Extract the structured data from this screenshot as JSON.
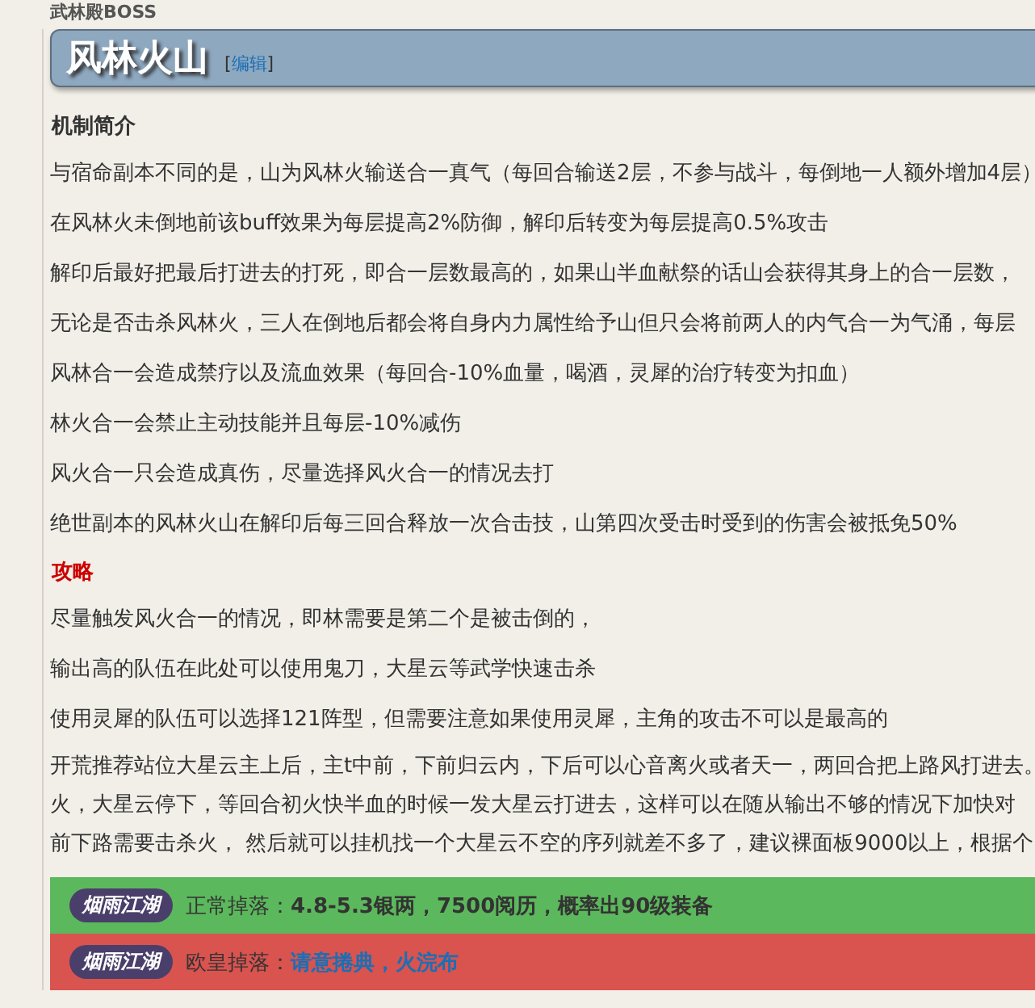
{
  "breadcrumb": "武林殿BOSS",
  "heading": {
    "title": "风林火山",
    "bracket_open": "[",
    "edit_link": "编辑",
    "bracket_close": "]"
  },
  "sections": [
    {
      "kind": "subtitle",
      "text": "机制简介"
    },
    {
      "kind": "para",
      "text": "与宿命副本不同的是，山为风林火输送合一真气（每回合输送2层，不参与战斗，每倒地一人额外增加4层）"
    },
    {
      "kind": "para",
      "text": "在风林火未倒地前该buff效果为每层提高2%防御，解印后转变为每层提高0.5%攻击"
    },
    {
      "kind": "para",
      "text": "解印后最好把最后打进去的打死，即合一层数最高的，如果山半血献祭的话山会获得其身上的合一层数，"
    },
    {
      "kind": "para",
      "text": "无论是否击杀风林火，三人在倒地后都会将自身内力属性给予山但只会将前两人的内气合一为气涌，每层"
    },
    {
      "kind": "para",
      "text": "风林合一会造成禁疗以及流血效果（每回合-10%血量，喝酒，灵犀的治疗转变为扣血）"
    },
    {
      "kind": "para",
      "text": "林火合一会禁止主动技能并且每层-10%减伤"
    },
    {
      "kind": "para",
      "text": "风火合一只会造成真伤，尽量选择风火合一的情况去打"
    },
    {
      "kind": "para",
      "text": "绝世副本的风林火山在解印后每三回合释放一次合击技，山第四次受击时受到的伤害会被抵免50%"
    },
    {
      "kind": "alert",
      "text": "攻略"
    },
    {
      "kind": "para",
      "text": "尽量触发风火合一的情况，即林需要是第二个是被击倒的，"
    },
    {
      "kind": "para",
      "text": "输出高的队伍在此处可以使用鬼刀，大星云等武学快速击杀"
    },
    {
      "kind": "para",
      "text": "使用灵犀的队伍可以选择121阵型，但需要注意如果使用灵犀，主角的攻击不可以是最高的"
    },
    {
      "kind": "block",
      "lines": [
        "开荒推荐站位大星云主上后，主t中前，下前归云内，下后可以心音离火或者天一，两回合把上路风打进去。",
        "火，大星云停下，等回合初火快半血的时候一发大星云打进去，这样可以在随从输出不够的情况下加快对",
        "前下路需要击杀火， 然后就可以挂机找一个大星云不空的序列就差不多了，建议裸面板9000以上，根据个"
      ]
    }
  ],
  "drops": [
    {
      "color": "#5cb85c",
      "logo": "烟雨江湖",
      "label": "正常掉落：",
      "text": "4.8-5.3银两，7500阅历，概率出90级装备"
    },
    {
      "color": "#d9534f",
      "logo": "烟雨江湖",
      "label": "欧皇掉落：",
      "links": [
        "请意捲典，火浣布"
      ]
    }
  ]
}
